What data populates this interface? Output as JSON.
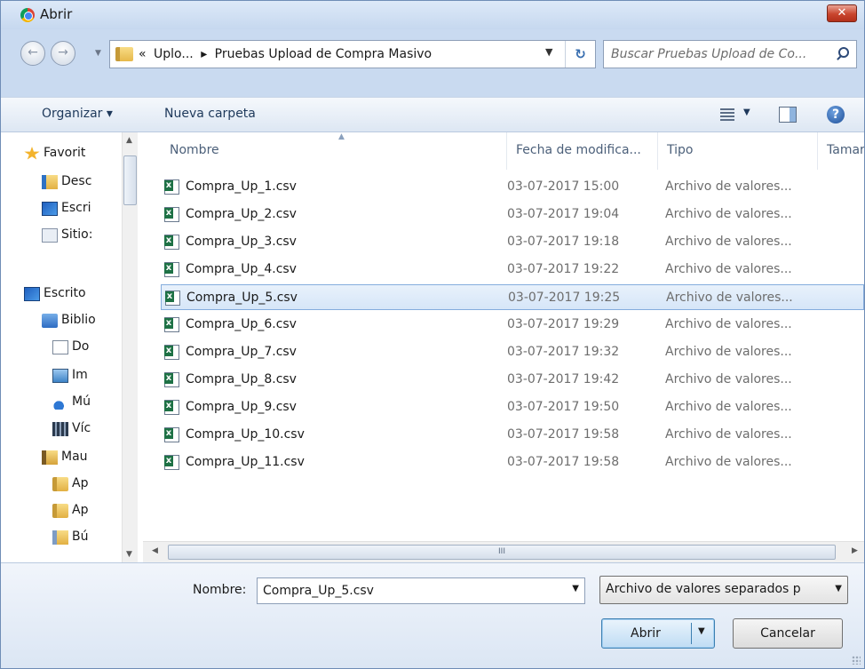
{
  "window": {
    "title": "Abrir",
    "close_glyph": "✕"
  },
  "address_bar": {
    "overflow_glyph": "«",
    "crumbs": [
      "Uplo...",
      "▸",
      "Pruebas Upload de Compra Masivo"
    ],
    "search_placeholder": "Buscar Pruebas Upload de Co..."
  },
  "toolbar": {
    "organize_label": "Organizar ▾",
    "new_folder_label": "Nueva carpeta",
    "help_glyph": "?"
  },
  "nav_pane": {
    "items": [
      {
        "label": "Favorit",
        "icon": "star-icon"
      },
      {
        "label": "Desc",
        "icon": "downloads-folder-icon"
      },
      {
        "label": "Escri",
        "icon": "desktop-icon"
      },
      {
        "label": "Sitio:",
        "icon": "sites-icon"
      },
      {
        "label": "Escrito",
        "icon": "desktop-icon"
      },
      {
        "label": "Biblio",
        "icon": "libraries-icon"
      },
      {
        "label": "Do",
        "icon": "documents-icon"
      },
      {
        "label": "Im",
        "icon": "pictures-icon"
      },
      {
        "label": "Mú",
        "icon": "music-icon"
      },
      {
        "label": "Víc",
        "icon": "videos-icon"
      },
      {
        "label": "Mau",
        "icon": "user-folder-icon"
      },
      {
        "label": "Ap",
        "icon": "folder-icon"
      },
      {
        "label": "Ap",
        "icon": "folder-icon"
      },
      {
        "label": "Bú",
        "icon": "search-folder-icon"
      }
    ]
  },
  "file_list": {
    "columns": [
      "Nombre",
      "Fecha de modifica...",
      "Tipo",
      "Tamar"
    ],
    "rows": [
      {
        "name": "Compra_Up_1.csv",
        "date": "03-07-2017 15:00",
        "type": "Archivo de valores..."
      },
      {
        "name": "Compra_Up_2.csv",
        "date": "03-07-2017 19:04",
        "type": "Archivo de valores..."
      },
      {
        "name": "Compra_Up_3.csv",
        "date": "03-07-2017 19:18",
        "type": "Archivo de valores..."
      },
      {
        "name": "Compra_Up_4.csv",
        "date": "03-07-2017 19:22",
        "type": "Archivo de valores..."
      },
      {
        "name": "Compra_Up_5.csv",
        "date": "03-07-2017 19:25",
        "type": "Archivo de valores..."
      },
      {
        "name": "Compra_Up_6.csv",
        "date": "03-07-2017 19:29",
        "type": "Archivo de valores..."
      },
      {
        "name": "Compra_Up_7.csv",
        "date": "03-07-2017 19:32",
        "type": "Archivo de valores..."
      },
      {
        "name": "Compra_Up_8.csv",
        "date": "03-07-2017 19:42",
        "type": "Archivo de valores..."
      },
      {
        "name": "Compra_Up_9.csv",
        "date": "03-07-2017 19:50",
        "type": "Archivo de valores..."
      },
      {
        "name": "Compra_Up_10.csv",
        "date": "03-07-2017 19:58",
        "type": "Archivo de valores..."
      },
      {
        "name": "Compra_Up_11.csv",
        "date": "03-07-2017 19:58",
        "type": "Archivo de valores..."
      }
    ],
    "selected_index": 4
  },
  "hscroll": {
    "thumb_glyph": "III"
  },
  "footer": {
    "filename_label": "Nombre:",
    "filename_value": "Compra_Up_5.csv",
    "filetype_value": "Archivo de valores separados p",
    "open_label": "Abrir",
    "cancel_label": "Cancelar"
  }
}
